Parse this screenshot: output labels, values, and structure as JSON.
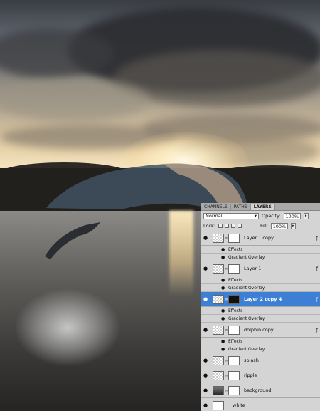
{
  "panel": {
    "tabs": [
      {
        "label": "CHANNELS",
        "active": false
      },
      {
        "label": "PATHS",
        "active": false
      },
      {
        "label": "LAYERS",
        "active": true
      }
    ],
    "blend_mode": "Normal",
    "opacity_label": "Opacity:",
    "opacity_value": "100%",
    "lock_label": "Lock:",
    "fill_label": "Fill:",
    "fill_value": "100%",
    "layers": [
      {
        "name": "Layer 1 copy",
        "effects_label": "Effects",
        "effect": "Gradient Overlay",
        "selected": false
      },
      {
        "name": "Layer 1",
        "effects_label": "Effects",
        "effect": "Gradient Overlay",
        "selected": false
      },
      {
        "name": "Layer 2 copy 4",
        "effects_label": "Effects",
        "effect": "Gradient Overlay",
        "selected": true
      },
      {
        "name": "dolphin copy",
        "effects_label": "Effects",
        "effect": "Gradient Overlay",
        "selected": false
      },
      {
        "name": "splash",
        "selected": false
      },
      {
        "name": "ripple",
        "selected": false
      },
      {
        "name": "background",
        "selected": false
      },
      {
        "name": "white",
        "selected": false
      }
    ]
  },
  "colors": {
    "selection": "#3e7fd6",
    "panel_bg": "#d4d4d4"
  }
}
